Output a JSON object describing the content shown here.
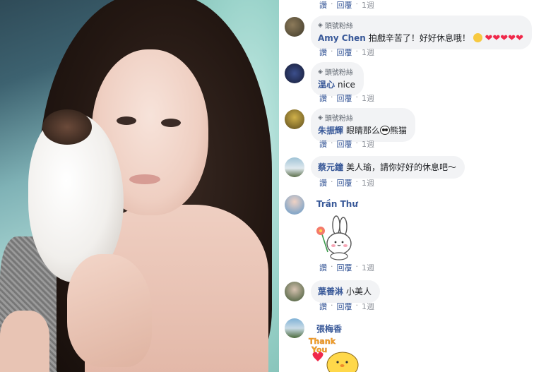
{
  "comments": [
    {
      "badge": "",
      "name": "",
      "text": "",
      "actions": {
        "like": "讚",
        "reply": "回覆",
        "time": "1週"
      }
    },
    {
      "badge": "頭號粉絲",
      "name": "Amy Chen",
      "text": "拍戲辛苦了！好好休息哦！",
      "emoji": "wink-heart-emoji",
      "actions": {
        "like": "讚",
        "reply": "回覆",
        "time": "1週"
      }
    },
    {
      "badge": "頭號粉絲",
      "name": "溫心",
      "text": "nice",
      "actions": {
        "like": "讚",
        "reply": "回覆",
        "time": "1週"
      }
    },
    {
      "badge": "頭號粉絲",
      "name": "朱振輝",
      "text": "眼睛那么",
      "text_after": "熊猫",
      "actions": {
        "like": "讚",
        "reply": "回覆",
        "time": "1週"
      }
    },
    {
      "name": "蔡元鐘",
      "text": "美人瑜，請你好好的休息吧～",
      "actions": {
        "like": "讚",
        "reply": "回覆",
        "time": "1週"
      }
    },
    {
      "name": "Trần Thư",
      "sticker": "bunny-flower-sticker",
      "actions": {
        "like": "讚",
        "reply": "回覆",
        "time": "1週"
      }
    },
    {
      "name": "葉善淋",
      "text": "小美人",
      "actions": {
        "like": "讚",
        "reply": "回覆",
        "time": "1週"
      }
    },
    {
      "name": "張梅香",
      "sticker": "thank-you-chick-sticker",
      "sticker_text": "Thank You"
    }
  ],
  "colors": {
    "link": "#385898",
    "bubble": "#f2f3f5",
    "muted": "#90949c",
    "heart": "#f0284a"
  }
}
